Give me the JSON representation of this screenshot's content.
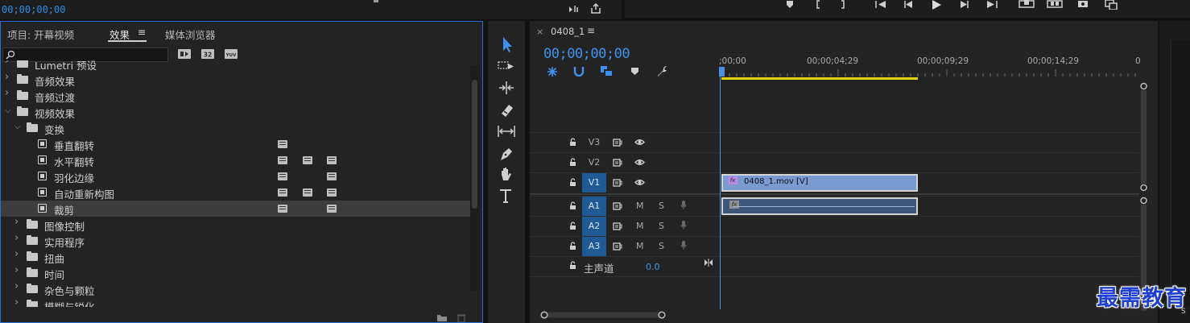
{
  "top_bar": {
    "timecode": "00;00;00;00"
  },
  "effects_panel": {
    "tabs": [
      {
        "label": "项目: 开幕视频"
      },
      {
        "label": "效果"
      },
      {
        "label": "媒体浏览器"
      }
    ],
    "active_tab": "效果",
    "menu_icon": "≡",
    "search": {
      "placeholder": "",
      "value": ""
    },
    "filter_badges": [
      "accelerated-badge-icon",
      "32bit-badge-icon",
      "yuv-badge-icon"
    ],
    "tree": [
      {
        "label": "Lumetri 预设",
        "type": "folder",
        "level": 0,
        "expanded": false,
        "partial": true
      },
      {
        "label": "音频效果",
        "type": "folder",
        "level": 0,
        "expanded": false
      },
      {
        "label": "音频过渡",
        "type": "folder",
        "level": 0,
        "expanded": false
      },
      {
        "label": "视频效果",
        "type": "folder",
        "level": 0,
        "expanded": true
      },
      {
        "label": "变换",
        "type": "folder",
        "level": 1,
        "expanded": true
      },
      {
        "label": "垂直翻转",
        "type": "effect",
        "level": 2,
        "badges": [
          "accelerated"
        ]
      },
      {
        "label": "水平翻转",
        "type": "effect",
        "level": 2,
        "badges": [
          "accelerated",
          "32bit",
          "yuv"
        ]
      },
      {
        "label": "羽化边缘",
        "type": "effect",
        "level": 2,
        "badges": [
          "accelerated",
          "yuv"
        ]
      },
      {
        "label": "自动重新构图",
        "type": "effect",
        "level": 2,
        "badges": [
          "accelerated",
          "32bit",
          "yuv"
        ]
      },
      {
        "label": "裁剪",
        "type": "effect",
        "level": 2,
        "badges": [
          "accelerated",
          "yuv"
        ],
        "selected": true
      },
      {
        "label": "图像控制",
        "type": "folder",
        "level": 1,
        "expanded": false
      },
      {
        "label": "实用程序",
        "type": "folder",
        "level": 1,
        "expanded": false
      },
      {
        "label": "扭曲",
        "type": "folder",
        "level": 1,
        "expanded": false
      },
      {
        "label": "时间",
        "type": "folder",
        "level": 1,
        "expanded": false
      },
      {
        "label": "杂色与颗粒",
        "type": "folder",
        "level": 1,
        "expanded": false
      },
      {
        "label": "模糊与锐化",
        "type": "folder",
        "level": 1,
        "expanded": false
      }
    ]
  },
  "tools": [
    "selection-tool",
    "track-select-tool",
    "ripple-edit-tool",
    "razor-tool",
    "slip-tool",
    "pen-tool",
    "hand-tool",
    "type-tool"
  ],
  "timeline": {
    "sequence_name": "0408_1",
    "menu_icon": "≡",
    "close_icon": "×",
    "timecode": "00;00;00;00",
    "ruler_labels": [
      ";00;00",
      "00;00;04;29",
      "00;00;09;29",
      "00;00;14;29",
      "0"
    ],
    "tracks": [
      {
        "name": "V3",
        "kind": "video",
        "targeted": false
      },
      {
        "name": "V2",
        "kind": "video",
        "targeted": false
      },
      {
        "name": "V1",
        "kind": "video",
        "targeted": true
      },
      {
        "name": "A1",
        "kind": "audio",
        "targeted": true,
        "mute": "M",
        "solo": "S"
      },
      {
        "name": "A2",
        "kind": "audio",
        "targeted": true,
        "mute": "M",
        "solo": "S"
      },
      {
        "name": "A3",
        "kind": "audio",
        "targeted": true,
        "mute": "M",
        "solo": "S"
      }
    ],
    "master": {
      "label": "主声道",
      "value": "0.0"
    },
    "clips": [
      {
        "track": "V1",
        "name": "0408_1.mov [V]",
        "color": "#7a9bd1"
      },
      {
        "track": "A1",
        "name": "",
        "color": "#3e5677"
      }
    ]
  },
  "watermark": "最需教育",
  "colors": {
    "accent": "#2d8ceb",
    "workarea": "#e8d400",
    "video_clip": "#7a9bd1",
    "audio_clip": "#3e5677",
    "track_target": "#1f5a94"
  }
}
